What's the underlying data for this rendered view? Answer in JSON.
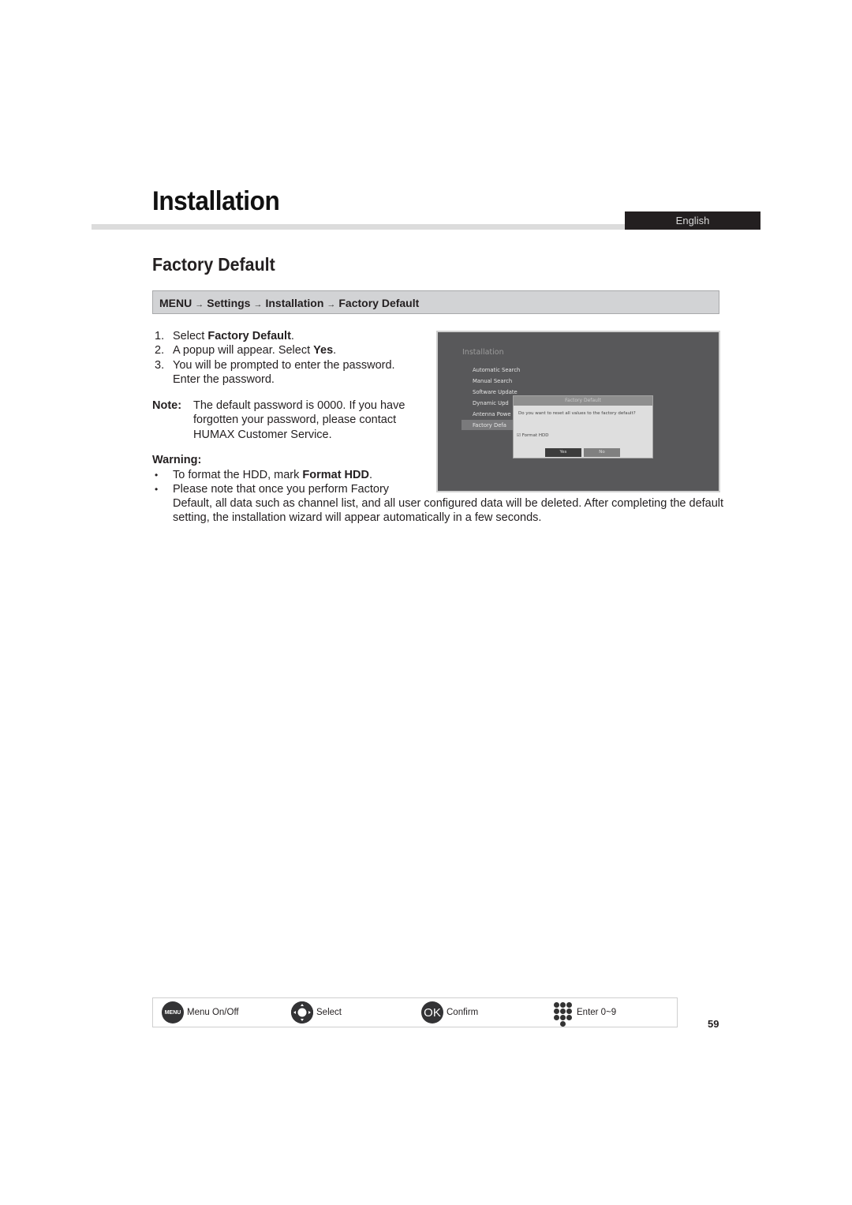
{
  "header": {
    "chapter_title": "Installation",
    "language_tab": "English"
  },
  "section": {
    "title": "Factory Default",
    "menu_path": [
      "MENU",
      "Settings",
      "Installation",
      "Factory Default"
    ],
    "arrow_glyph": "→"
  },
  "steps": [
    {
      "num": "1.",
      "pre": "Select ",
      "bold": "Factory Default",
      "post": "."
    },
    {
      "num": "2.",
      "pre": "A popup will appear. Select ",
      "bold": "Yes",
      "post": "."
    },
    {
      "num": "3.",
      "pre": "You will be prompted to enter the password. Enter the password.",
      "bold": "",
      "post": ""
    }
  ],
  "note": {
    "label": "Note:",
    "text": "The default password is 0000. If you have forgotten your password, please contact HUMAX Customer Service."
  },
  "warning": {
    "heading": "Warning:",
    "bullet_glyph": "•",
    "bullet1_pre": "To format the HDD, mark ",
    "bullet1_bold": "Format HDD",
    "bullet1_post": ".",
    "bullet2_first_line": "Please note that once you perform Factory",
    "bullet2_rest": "Default, all data such as channel list, and all user configured data will be deleted. After completing the default setting, the installation wizard will appear automatically in a few seconds."
  },
  "tv_screen": {
    "title": "Installation",
    "menu_items": [
      "Automatic Search",
      "Manual Search",
      "Software Update",
      "Dynamic Upd",
      "Antenna Powe",
      "Factory Defa"
    ],
    "selected_index": 5,
    "dialog": {
      "title": "Factory Default",
      "message": "Do you want to reset all values to the factory default?",
      "checkbox_label": "Format HDD",
      "checkbox_checked": true,
      "yes_label": "Yes",
      "no_label": "No"
    }
  },
  "footer": {
    "menu_icon_text": "MENU",
    "menu_label": "Menu On/Off",
    "select_label": "Select",
    "ok_icon_text": "OK",
    "confirm_label": "Confirm",
    "enter_label": "Enter 0~9"
  },
  "page_number": "59"
}
